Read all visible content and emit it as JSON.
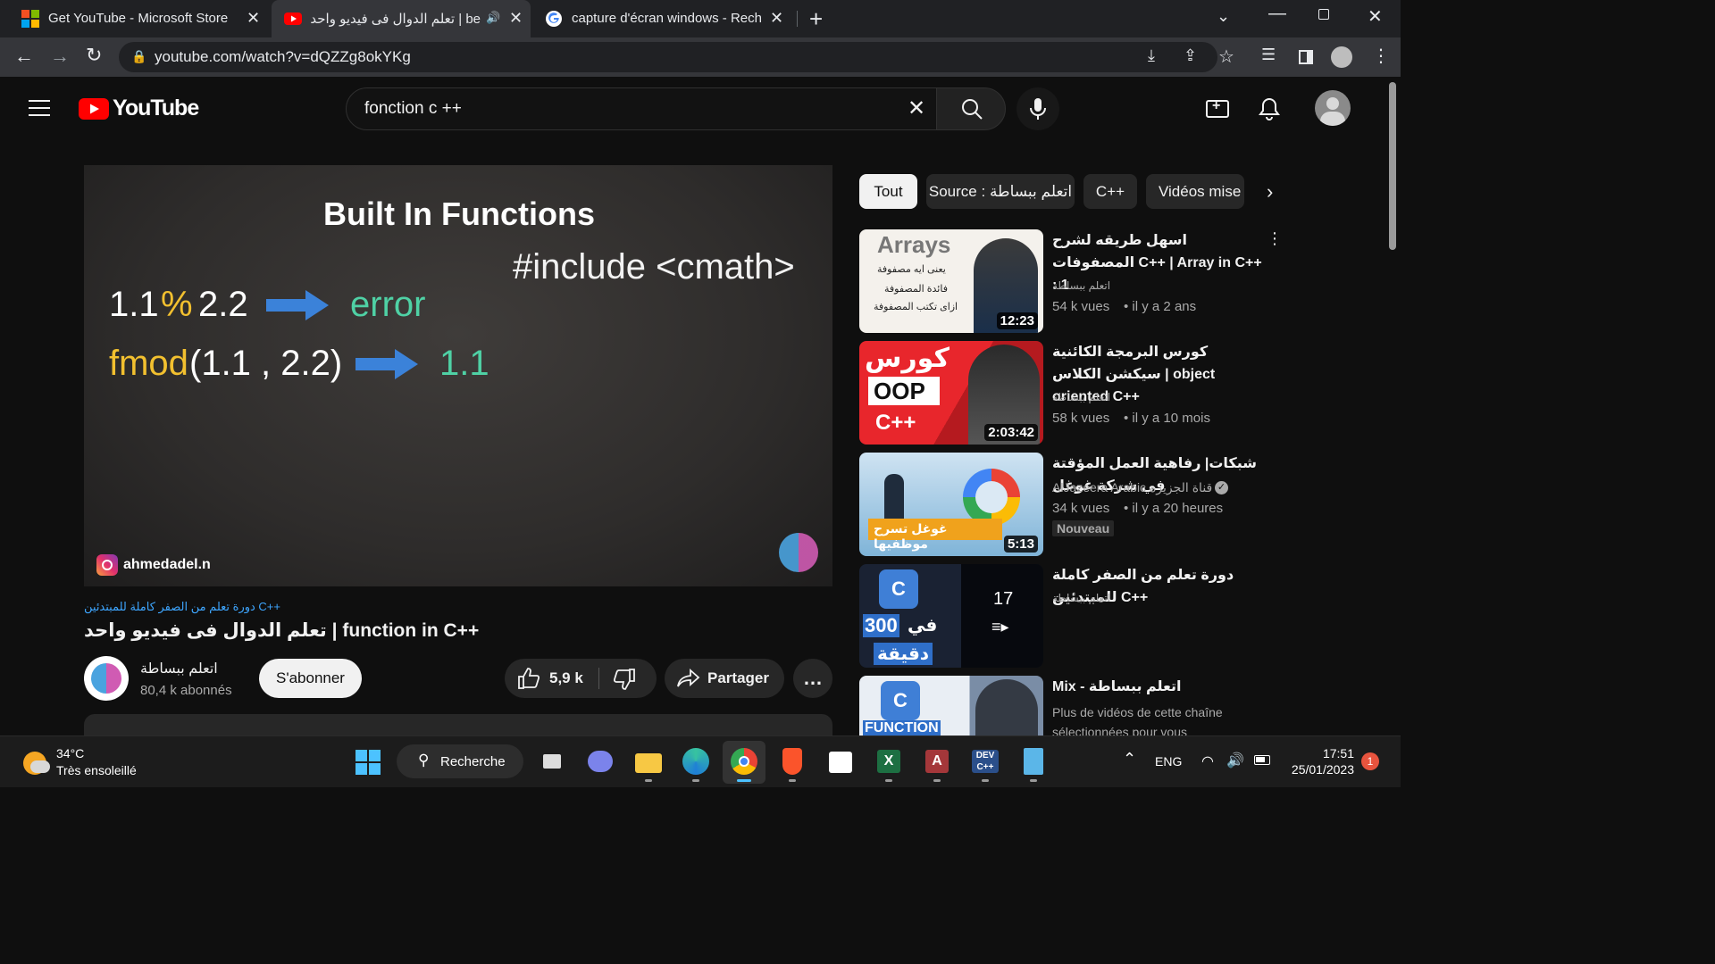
{
  "browser": {
    "tabs": [
      {
        "title": "Get YouTube - Microsoft Store"
      },
      {
        "title": "be | تعلم الدوال فى فيديو واحد"
      },
      {
        "title": "capture d'écran windows - Reche"
      }
    ],
    "url": "youtube.com/watch?v=dQZZg8okYKg"
  },
  "youtube": {
    "logo_text": "YouTube",
    "search_value": "fonction c ++",
    "video": {
      "slide": {
        "heading": "Built In Functions",
        "include": "#include <cmath>",
        "line1_left": "1.1",
        "line1_op": "%",
        "line1_right": "2.2",
        "line1_result": "error",
        "line2_fn": "fmod",
        "line2_args": "(1.1 , 2.2)",
        "line2_result": "1.1",
        "watermark": "ahmedadel.n"
      },
      "playlist_label": "دورة تعلم من الصفر كاملة للمبتدئين C++",
      "title": "تعلم الدوال فى فيديو واحد | function in C++",
      "channel_name": "اتعلم ببساطة",
      "subscribers": "80,4 k abonnés",
      "subscribe_label": "S'abonner",
      "likes": "5,9 k",
      "share_label": "Partager",
      "more_label": "…"
    },
    "chips": [
      "Tout",
      "Source : اتعلم ببساطة",
      "C++",
      "Vidéos mise"
    ],
    "recommendations": [
      {
        "title": "اسهل طريقه لشرح المصفوفات C++ | Array in C++ : 1",
        "channel": "اتعلم ببساطة",
        "views": "54 k vues",
        "age": "il y a 2 ans",
        "duration": "12:23",
        "thumb_text_main": "Arrays",
        "thumb_lines": [
          "يعنى ايه مصفوفة",
          "فائدة المصفوفة",
          "ازاى تكتب المصفوفة"
        ]
      },
      {
        "title": "كورس البرمجة الكائنية سيكشن الكلاس | object oriented C++",
        "channel": "اتعلم ببساطة",
        "views": "58 k vues",
        "age": "il y a 10 mois",
        "duration": "2:03:42",
        "thumb_lines": [
          "كورس",
          "OOP",
          "C++"
        ]
      },
      {
        "title": "شبكات| رفاهية العمل المؤقتة في شركة غوغل",
        "channel": "AlJazeera Arabic قناة الجزيرة",
        "views": "34 k vues",
        "age": "il y a 20 heures",
        "duration": "5:13",
        "badge": "Nouveau",
        "thumb_caption": "غوغل تسرح موظفيها"
      },
      {
        "title": "دورة تعلم من الصفر كاملة للمبتدئين C++",
        "channel": "اتعلم ببساطة",
        "playlist_count": "17",
        "thumb_lines": [
          "300",
          "في",
          "دقيقة"
        ]
      },
      {
        "title": "Mix - اتعلم ببساطة",
        "subtitle": "Plus de vidéos de cette chaîne sélectionnées pour vous",
        "thumb_text_main": "FUNCTION"
      }
    ]
  },
  "taskbar": {
    "weather_temp": "34°C",
    "weather_desc": "Très ensoleillé",
    "search_label": "Recherche",
    "lang": "ENG",
    "time": "17:51",
    "date": "25/01/2023",
    "notification_count": "1"
  },
  "colors": {
    "yt_red": "#ff0000",
    "slide_yellow": "#f2c02f",
    "slide_green": "#4fd1a5",
    "arrow_blue": "#3b82d9",
    "link_blue": "#3ea6ff"
  }
}
